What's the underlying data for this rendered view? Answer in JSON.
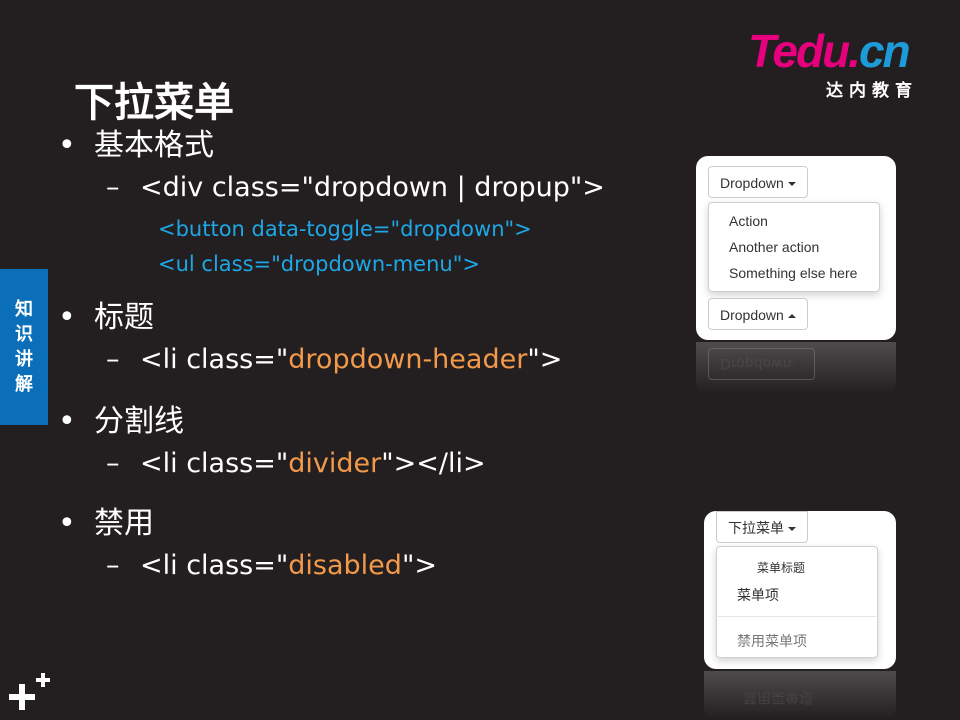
{
  "brand": {
    "logo_main_t": "T",
    "logo_main_rest": "edu.",
    "logo_main_cn": "cn",
    "logo_sub": "达内教育"
  },
  "slide": {
    "title": "下拉菜单",
    "side_tab": [
      "知",
      "识",
      "讲",
      "解"
    ]
  },
  "content": {
    "bullet_glyph": "•",
    "dash_glyph": "–",
    "basic": {
      "heading": "基本格式",
      "line1": "<div class=\"dropdown | dropup\">",
      "code1": "<button data-toggle=\"dropdown\">",
      "code2": "<ul class=\"dropdown-menu\">"
    },
    "header": {
      "heading": "标题",
      "pre": "<li class=\"",
      "value": "dropdown-header",
      "post": "\">"
    },
    "divider": {
      "heading": "分割线",
      "pre": "<li class=\"",
      "value": "divider",
      "post": "\"></li>"
    },
    "disabled": {
      "heading": "禁用",
      "pre": "<li class=\"",
      "value": "disabled",
      "post": "\">"
    }
  },
  "demo1": {
    "button_label": "Dropdown",
    "items": [
      "Action",
      "Another action",
      "Something else here"
    ],
    "dropup_label": "Dropdown",
    "reflection_label": "Dropdown"
  },
  "demo2": {
    "button_label": "下拉菜单",
    "header": "菜单标题",
    "item": "菜单项",
    "disabled_item": "禁用菜单项",
    "reflection_label": "禁用菜单项"
  },
  "colors": {
    "background": "#231f20",
    "accent_blue": "#1ea7e6",
    "accent_orange": "#f39a4a",
    "side_tab": "#0a6fb8"
  }
}
